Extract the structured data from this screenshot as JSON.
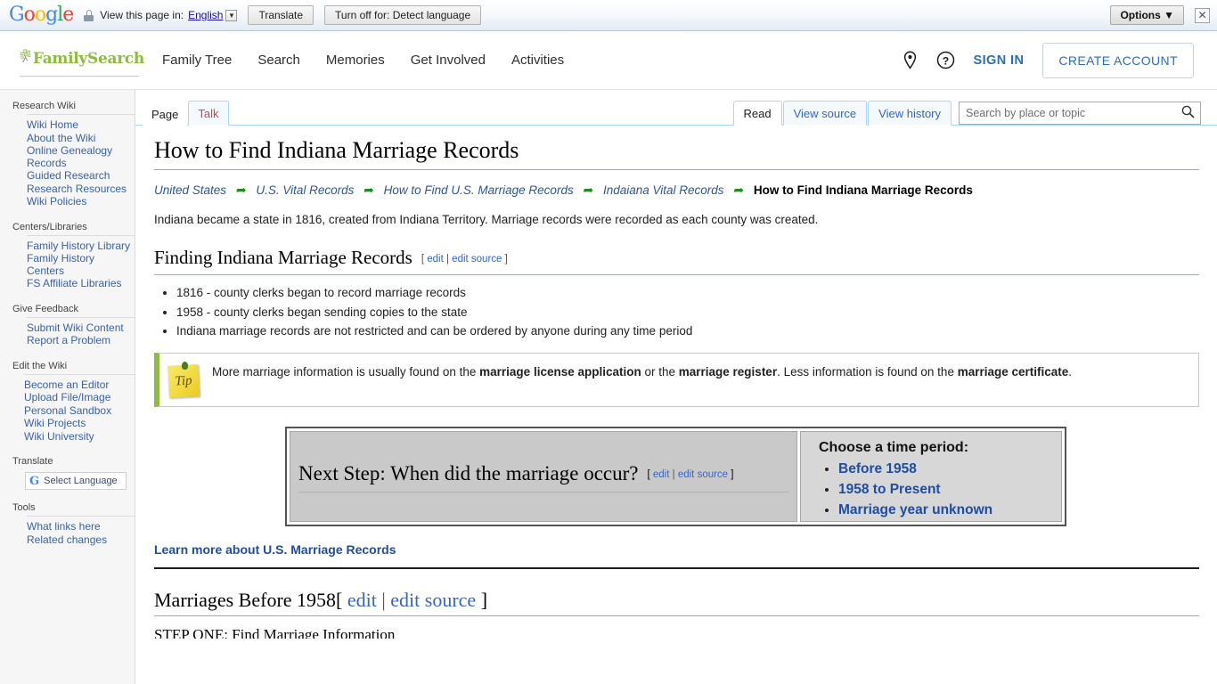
{
  "translate_bar": {
    "logo": "Google",
    "lock_icon": "lock-icon",
    "view_label": "View this page in:",
    "language": "English",
    "translate_button": "Translate",
    "turnoff_button": "Turn off for: Detect language",
    "options_button": "Options ▼",
    "close_icon": "✕"
  },
  "header": {
    "logo_text": "FamilySearch",
    "nav": [
      {
        "label": "Family Tree"
      },
      {
        "label": "Search"
      },
      {
        "label": "Memories"
      },
      {
        "label": "Get Involved"
      },
      {
        "label": "Activities"
      }
    ],
    "location_icon": "map-pin-icon",
    "help_icon": "question-circle-icon",
    "sign_in": "SIGN IN",
    "create_account": "CREATE ACCOUNT",
    "brand_green": "#8FBC3F",
    "link_blue": "#2a6ebb"
  },
  "sidebar": {
    "groups": [
      {
        "title": "Research Wiki",
        "items": [
          "Wiki Home",
          "About the Wiki",
          "Online Genealogy Records",
          "Guided Research",
          "Research Resources",
          "Wiki Policies"
        ]
      },
      {
        "title": "Centers/Libraries",
        "items": [
          "Family History Library",
          "Family History Centers",
          "FS Affiliate Libraries"
        ]
      },
      {
        "title": "Give Feedback",
        "items": [
          "Submit Wiki Content",
          "Report a Problem"
        ]
      },
      {
        "title": "Edit the Wiki",
        "items": [
          "Become an Editor",
          "Upload File/Image",
          "Personal Sandbox",
          "Wiki Projects",
          "Wiki University"
        ]
      },
      {
        "title": "Translate",
        "items": []
      },
      {
        "title": "Tools",
        "items": [
          "What links here",
          "Related changes"
        ]
      }
    ],
    "select_language": "Select Language"
  },
  "tabs": {
    "namespace": [
      {
        "label": "Page",
        "selected": true
      },
      {
        "label": "Talk",
        "selected": false
      }
    ],
    "actions": [
      {
        "label": "Read",
        "selected": true
      },
      {
        "label": "View source",
        "selected": false
      },
      {
        "label": "View history",
        "selected": false
      }
    ]
  },
  "search": {
    "placeholder": "Search by place or topic",
    "value": "",
    "icon": "search-icon"
  },
  "article": {
    "title": "How to Find Indiana Marriage Records",
    "breadcrumb": [
      {
        "label": "United States",
        "current": false
      },
      {
        "label": "U.S. Vital Records",
        "current": false
      },
      {
        "label": "How to Find U.S. Marriage Records",
        "current": false
      },
      {
        "label": "Indaiana Vital Records",
        "current": false
      },
      {
        "label": "How to Find Indiana Marriage Records",
        "current": true
      }
    ],
    "breadcrumb_arrow": "➦",
    "intro": "Indiana became a state in 1816, created from Indiana Territory. Marriage records were recorded as each county was created.",
    "section1": {
      "heading": "Finding Indiana Marriage Records",
      "edit": "edit",
      "edit_source": "edit source",
      "bullets": [
        "1816 - county clerks began to record marriage records",
        "1958 - county clerks began sending copies to the state",
        "Indiana marriage records are not restricted and can be ordered by anyone during any time period"
      ]
    },
    "tip": {
      "icon_label": "Tip",
      "part1": "More marriage information is usually found on the ",
      "bold1": "marriage license application",
      "part2": " or the ",
      "bold2": "marriage register",
      "part3": ". Less information is found on the ",
      "bold3": "marriage certificate",
      "part4": "."
    },
    "nextstep": {
      "question": "Next Step: When did the marriage occur?",
      "edit": "edit",
      "edit_source": "edit source",
      "choose_heading": "Choose a time period:",
      "options": [
        "Before 1958",
        "1958 to Present",
        "Marriage year unknown"
      ]
    },
    "learn_more": "Learn more about U.S. Marriage Records",
    "section2": {
      "heading": "Marriages Before 1958",
      "edit": "edit",
      "edit_source": "edit source"
    },
    "step_one_partial": "STEP ONE: Find Marriage Information"
  }
}
